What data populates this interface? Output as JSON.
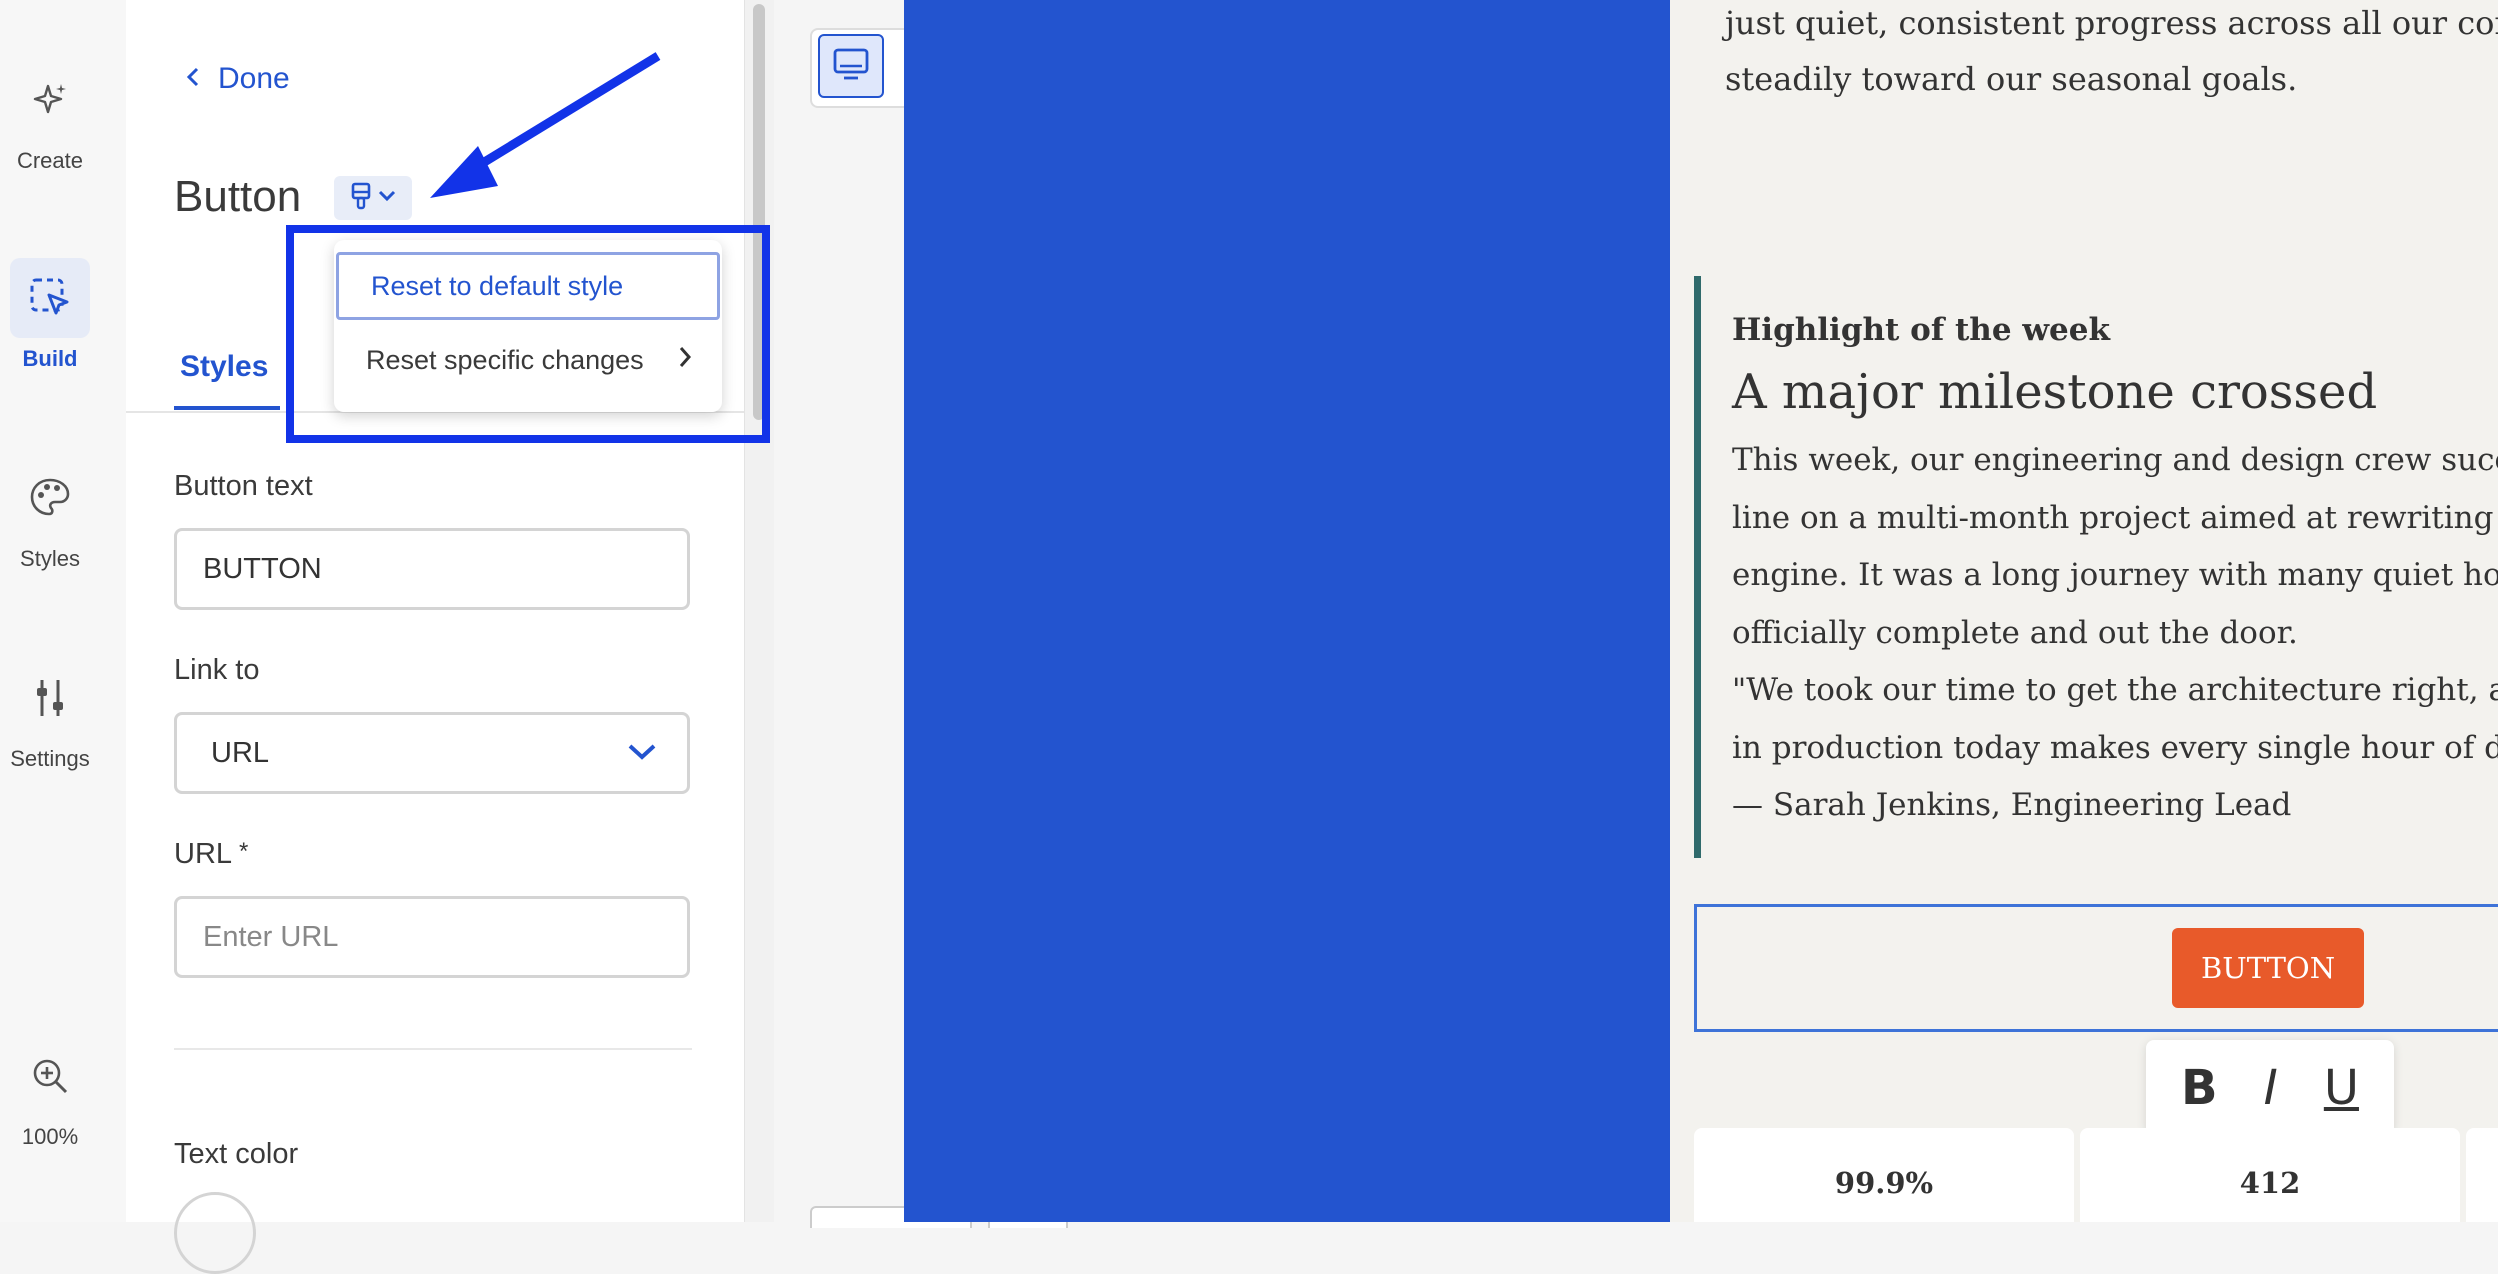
{
  "rail": {
    "items": [
      {
        "label": "Create",
        "icon": "sparkle-icon"
      },
      {
        "label": "Build",
        "icon": "select-cursor-icon",
        "active": true
      },
      {
        "label": "Styles",
        "icon": "palette-icon"
      },
      {
        "label": "Settings",
        "icon": "sliders-icon"
      }
    ],
    "zoom": "100%"
  },
  "panel": {
    "back_label": "Done",
    "title": "Button",
    "tab": "Styles",
    "button_text_label": "Button text",
    "button_text_value": "BUTTON",
    "link_to_label": "Link to",
    "link_to_value": "URL",
    "url_label": "URL",
    "url_required": "*",
    "url_placeholder": "Enter URL",
    "text_color_label": "Text color"
  },
  "menu": {
    "items": [
      "Reset to default style",
      "Reset specific changes"
    ]
  },
  "colors": {
    "accent": "#2354cf",
    "annotation": "#1233e8",
    "cta": "#e85a2a",
    "quote_bar": "#2f6a6b"
  },
  "email": {
    "intro_line1": "just quiet, consistent progress across all our core initia",
    "intro_line2": "steadily toward our seasonal goals.",
    "highlight_label": "Highlight of the week",
    "highlight_title": "A major milestone crossed",
    "body_lines": [
      "This week, our engineering and design crew successfu",
      "line on a multi-month project aimed at rewriting our",
      "engine. It was a long journey with many quiet hours of",
      "officially complete and out the door.",
      "\"We took our time to get the architecture right, and se",
      "in production today makes every single hour of drafti",
      "— Sarah Jenkins, Engineering Lead"
    ],
    "button_label": "BUTTON",
    "format_buttons": [
      "B",
      "I",
      "U"
    ],
    "stats": [
      "99.9%",
      "412"
    ]
  }
}
